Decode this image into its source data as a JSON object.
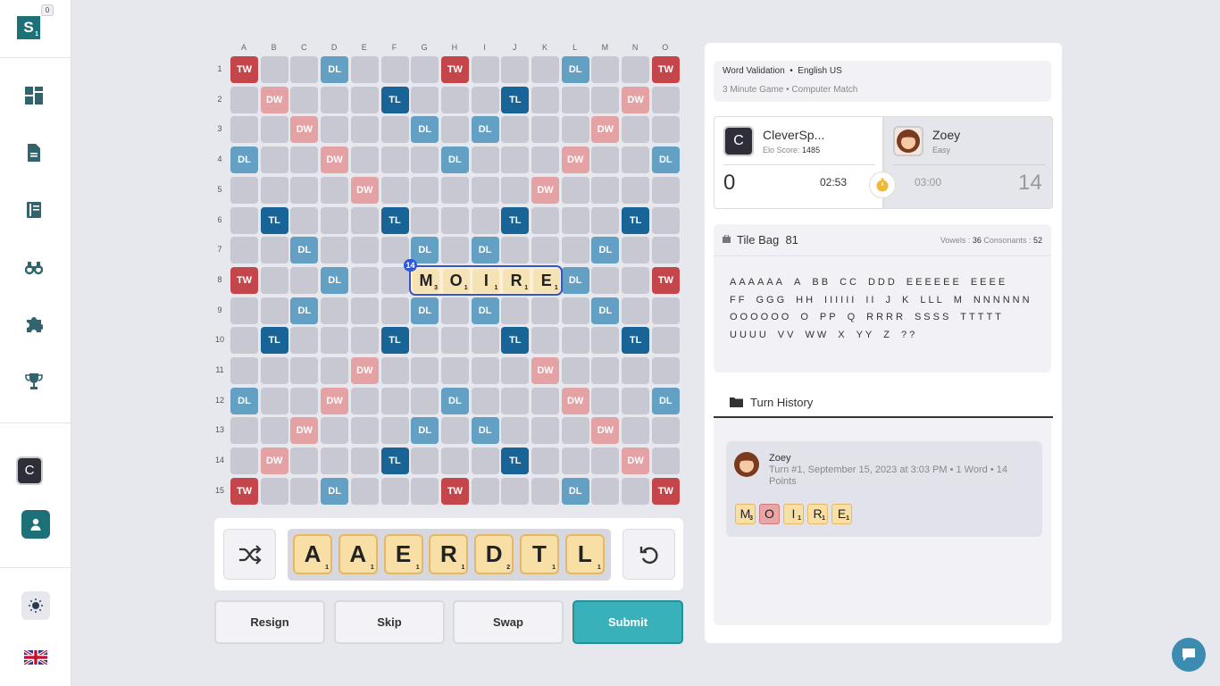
{
  "sidebar": {
    "logo_letter": "S",
    "logo_sub": "1",
    "notification_count": "0",
    "avatar_letter": "C"
  },
  "board": {
    "columns": [
      "A",
      "B",
      "C",
      "D",
      "E",
      "F",
      "G",
      "H",
      "I",
      "J",
      "K",
      "L",
      "M",
      "N",
      "O"
    ],
    "rows": [
      "1",
      "2",
      "3",
      "4",
      "5",
      "6",
      "7",
      "8",
      "9",
      "10",
      "11",
      "12",
      "13",
      "14",
      "15"
    ],
    "premium": [
      [
        "TW",
        "",
        "",
        "DL",
        "",
        "",
        "",
        "TW",
        "",
        "",
        "",
        "DL",
        "",
        "",
        "TW"
      ],
      [
        "",
        "DW",
        "",
        "",
        "",
        "TL",
        "",
        "",
        "",
        "TL",
        "",
        "",
        "",
        "DW",
        ""
      ],
      [
        "",
        "",
        "DW",
        "",
        "",
        "",
        "DL",
        "",
        "DL",
        "",
        "",
        "",
        "DW",
        "",
        ""
      ],
      [
        "DL",
        "",
        "",
        "DW",
        "",
        "",
        "",
        "DL",
        "",
        "",
        "",
        "DW",
        "",
        "",
        "DL"
      ],
      [
        "",
        "",
        "",
        "",
        "DW",
        "",
        "",
        "",
        "",
        "",
        "DW",
        "",
        "",
        "",
        ""
      ],
      [
        "",
        "TL",
        "",
        "",
        "",
        "TL",
        "",
        "",
        "",
        "TL",
        "",
        "",
        "",
        "TL",
        ""
      ],
      [
        "",
        "",
        "DL",
        "",
        "",
        "",
        "DL",
        "",
        "DL",
        "",
        "",
        "",
        "DL",
        "",
        ""
      ],
      [
        "TW",
        "",
        "",
        "DL",
        "",
        "",
        "",
        "",
        "",
        "",
        "",
        "DL",
        "",
        "",
        "TW"
      ],
      [
        "",
        "",
        "DL",
        "",
        "",
        "",
        "DL",
        "",
        "DL",
        "",
        "",
        "",
        "DL",
        "",
        ""
      ],
      [
        "",
        "TL",
        "",
        "",
        "",
        "TL",
        "",
        "",
        "",
        "TL",
        "",
        "",
        "",
        "TL",
        ""
      ],
      [
        "",
        "",
        "",
        "",
        "DW",
        "",
        "",
        "",
        "",
        "",
        "DW",
        "",
        "",
        "",
        ""
      ],
      [
        "DL",
        "",
        "",
        "DW",
        "",
        "",
        "",
        "DL",
        "",
        "",
        "",
        "DW",
        "",
        "",
        "DL"
      ],
      [
        "",
        "",
        "DW",
        "",
        "",
        "",
        "DL",
        "",
        "DL",
        "",
        "",
        "",
        "DW",
        "",
        ""
      ],
      [
        "",
        "DW",
        "",
        "",
        "",
        "TL",
        "",
        "",
        "",
        "TL",
        "",
        "",
        "",
        "DW",
        ""
      ],
      [
        "TW",
        "",
        "",
        "DL",
        "",
        "",
        "",
        "TW",
        "",
        "",
        "",
        "DL",
        "",
        "",
        "TW"
      ]
    ],
    "placed_word_score": "14",
    "placed_tiles": [
      {
        "letter": "M",
        "points": "3"
      },
      {
        "letter": "O",
        "points": "1"
      },
      {
        "letter": "I",
        "points": "1"
      },
      {
        "letter": "R",
        "points": "1"
      },
      {
        "letter": "E",
        "points": "1"
      }
    ]
  },
  "rack": {
    "tiles": [
      {
        "letter": "A",
        "points": "1"
      },
      {
        "letter": "A",
        "points": "1"
      },
      {
        "letter": "E",
        "points": "1"
      },
      {
        "letter": "R",
        "points": "1"
      },
      {
        "letter": "D",
        "points": "2"
      },
      {
        "letter": "T",
        "points": "1"
      },
      {
        "letter": "L",
        "points": "1"
      }
    ]
  },
  "actions": {
    "resign": "Resign",
    "skip": "Skip",
    "swap": "Swap",
    "submit": "Submit"
  },
  "game_info": {
    "validation": "Word Validation",
    "language": "English US",
    "mode": "3 Minute Game • Computer Match"
  },
  "players": {
    "p1": {
      "avatar": "C",
      "name": "CleverSp...",
      "elo_label": "Elo Score:",
      "elo": "1485",
      "score": "0",
      "time": "02:53"
    },
    "p2": {
      "name": "Zoey",
      "level": "Easy",
      "score": "14",
      "time": "03:00"
    }
  },
  "tile_bag": {
    "title": "Tile Bag",
    "count": "81",
    "vowels_label": "Vowels :",
    "vowels": "36",
    "consonants_label": "Consonants :",
    "consonants": "52",
    "groups": [
      "AAAAAA",
      "A",
      "BB",
      "CC",
      "DDD",
      "EEEEEE",
      "EEEE",
      "FF",
      "GGG",
      "HH",
      "IIIIII",
      "II",
      "J",
      "K",
      "LLL",
      "M",
      "NNNNNN",
      "OOOOOO",
      "O",
      "PP",
      "Q",
      "RRRR",
      "SSSS",
      "TTTTT",
      "UUUU",
      "VV",
      "WW",
      "X",
      "YY",
      "Z",
      "??"
    ]
  },
  "history": {
    "title": "Turn History",
    "entry_player": "Zoey",
    "entry_meta": "Turn #1, September 15, 2023 at 3:03 PM • 1 Word • 14 Points",
    "entry_tiles": [
      {
        "letter": "M",
        "points": "3",
        "pink": false
      },
      {
        "letter": "O",
        "points": "",
        "pink": true
      },
      {
        "letter": "I",
        "points": "1",
        "pink": false
      },
      {
        "letter": "R",
        "points": "1",
        "pink": false
      },
      {
        "letter": "E",
        "points": "1",
        "pink": false
      }
    ]
  },
  "colors": {
    "TW": "#c5464a",
    "DW": "#e4a2a4",
    "TL": "#186497",
    "DL": "#63a0c4",
    "empty": "#c8c8d2",
    "brand": "#1d6f78",
    "submit": "#39b1bb"
  }
}
